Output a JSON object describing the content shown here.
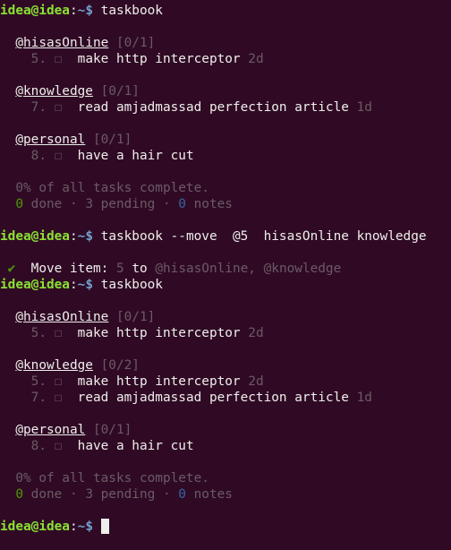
{
  "prompt": {
    "user": "idea@idea",
    "colon": ":",
    "path": "~$ ",
    "color_user": "#8ae234",
    "color_path": "#729fcf"
  },
  "commands": [
    "taskbook",
    "taskbook --move  @5  hisasOnline knowledge",
    "taskbook"
  ],
  "run1": {
    "boards": [
      {
        "name": "@hisasOnline",
        "count": "[0/1]",
        "items": [
          {
            "id": "5.",
            "text": "make http interceptor",
            "age": "2d"
          }
        ]
      },
      {
        "name": "@knowledge",
        "count": "[0/1]",
        "items": [
          {
            "id": "7.",
            "text": "read amjadmassad perfection article",
            "age": "1d"
          }
        ]
      },
      {
        "name": "@personal",
        "count": "[0/1]",
        "items": [
          {
            "id": "8.",
            "text": "have a hair cut",
            "age": ""
          }
        ]
      }
    ],
    "summary": "0% of all tasks complete.",
    "done_count": "0",
    "done_label": " done",
    "pending": " · 3 pending · ",
    "notes_count": "0",
    "notes_label": " notes"
  },
  "move_result": {
    "check": "✔",
    "label": "Move item:",
    "item": "5",
    "to": "to",
    "boards": "@hisasOnline, @knowledge"
  },
  "run2": {
    "boards": [
      {
        "name": "@hisasOnline",
        "count": "[0/1]",
        "items": [
          {
            "id": "5.",
            "text": "make http interceptor",
            "age": "2d"
          }
        ]
      },
      {
        "name": "@knowledge",
        "count": "[0/2]",
        "items": [
          {
            "id": "5.",
            "text": "make http interceptor",
            "age": "2d"
          },
          {
            "id": "7.",
            "text": "read amjadmassad perfection article",
            "age": "1d"
          }
        ]
      },
      {
        "name": "@personal",
        "count": "[0/1]",
        "items": [
          {
            "id": "8.",
            "text": "have a hair cut",
            "age": ""
          }
        ]
      }
    ],
    "summary": "0% of all tasks complete.",
    "done_count": "0",
    "done_label": " done",
    "pending": " · 3 pending · ",
    "notes_count": "0",
    "notes_label": " notes"
  },
  "checkbox_glyph": "☐"
}
